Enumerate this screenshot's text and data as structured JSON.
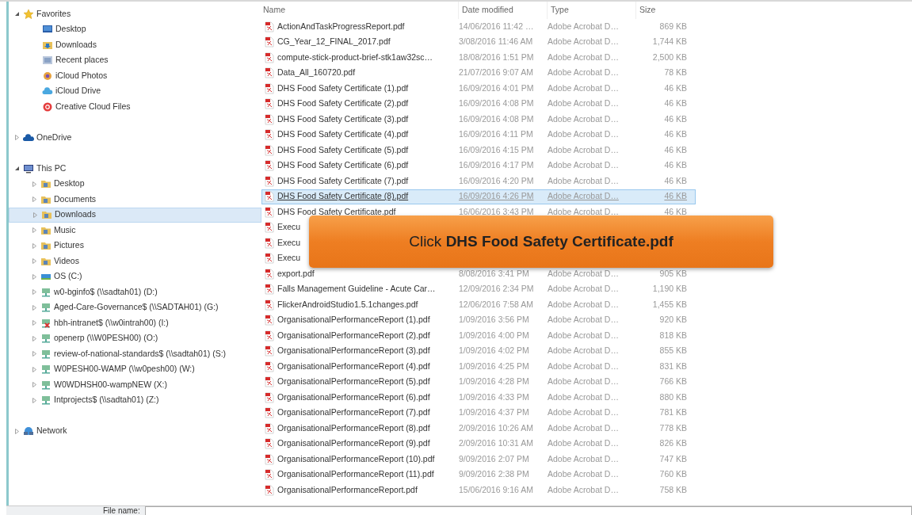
{
  "navigation": [
    {
      "label": "Favorites",
      "kind": "favorites",
      "expanded": true,
      "selected": false,
      "children": [
        {
          "label": "Desktop",
          "kind": "desktop",
          "selected": false
        },
        {
          "label": "Downloads",
          "kind": "downloads",
          "selected": false
        },
        {
          "label": "Recent places",
          "kind": "recent",
          "selected": false
        },
        {
          "label": "iCloud Photos",
          "kind": "photos",
          "selected": false
        },
        {
          "label": "iCloud Drive",
          "kind": "cloud",
          "selected": false
        },
        {
          "label": "Creative Cloud Files",
          "kind": "creative",
          "selected": false
        }
      ]
    },
    {
      "label": "OneDrive",
      "kind": "onedrive",
      "expanded": false,
      "selected": false
    },
    {
      "label": "This PC",
      "kind": "computer",
      "expanded": true,
      "selected": false,
      "children": [
        {
          "label": "Desktop",
          "kind": "folder",
          "expanded": false,
          "selected": false
        },
        {
          "label": "Documents",
          "kind": "folder",
          "expanded": false,
          "selected": false
        },
        {
          "label": "Downloads",
          "kind": "folder",
          "expanded": false,
          "selected": true
        },
        {
          "label": "Music",
          "kind": "folder",
          "expanded": false,
          "selected": false
        },
        {
          "label": "Pictures",
          "kind": "folder",
          "expanded": false,
          "selected": false
        },
        {
          "label": "Videos",
          "kind": "folder",
          "expanded": false,
          "selected": false
        },
        {
          "label": "OS (C:)",
          "kind": "disk",
          "expanded": false,
          "selected": false
        },
        {
          "label": "w0-bginfo$ (\\\\sadtah01) (D:)",
          "kind": "network-drive",
          "expanded": false,
          "selected": false
        },
        {
          "label": "Aged-Care-Governance$ (\\\\SADTAH01) (G:)",
          "kind": "network-drive",
          "expanded": false,
          "selected": false
        },
        {
          "label": "hbh-intranet$ (\\\\w0intrah00) (I:)",
          "kind": "disconnected-drive",
          "expanded": false,
          "selected": false
        },
        {
          "label": "openerp (\\\\W0PESH00) (O:)",
          "kind": "network-drive",
          "expanded": false,
          "selected": false
        },
        {
          "label": "review-of-national-standards$ (\\\\sadtah01) (S:)",
          "kind": "network-drive",
          "expanded": false,
          "selected": false
        },
        {
          "label": "W0PESH00-WAMP (\\\\w0pesh00) (W:)",
          "kind": "network-drive",
          "expanded": false,
          "selected": false
        },
        {
          "label": "W0WDHSH00-wampNEW (X:)",
          "kind": "network-drive",
          "expanded": false,
          "selected": false
        },
        {
          "label": "Intprojects$ (\\\\sadtah01) (Z:)",
          "kind": "network-drive",
          "expanded": false,
          "selected": false
        }
      ]
    },
    {
      "label": "Network",
      "kind": "network",
      "expanded": false,
      "selected": false
    }
  ],
  "file_list": {
    "columns": [
      "Name",
      "Date modified",
      "Type",
      "Size"
    ],
    "rows": [
      {
        "name": "ActionAndTaskProgressReport.pdf",
        "date": "14/06/2016 11:42 …",
        "type": "Adobe Acrobat D…",
        "size": "869 KB",
        "selected": false
      },
      {
        "name": "CG_Year_12_FINAL_2017.pdf",
        "date": "3/08/2016 11:46 AM",
        "type": "Adobe Acrobat D…",
        "size": "1,744 KB",
        "selected": false
      },
      {
        "name": "compute-stick-product-brief-stk1aw32sc…",
        "date": "18/08/2016 1:51 PM",
        "type": "Adobe Acrobat D…",
        "size": "2,500 KB",
        "selected": false
      },
      {
        "name": "Data_All_160720.pdf",
        "date": "21/07/2016 9:07 AM",
        "type": "Adobe Acrobat D…",
        "size": "78 KB",
        "selected": false
      },
      {
        "name": "DHS Food Safety Certificate (1).pdf",
        "date": "16/09/2016 4:01 PM",
        "type": "Adobe Acrobat D…",
        "size": "46 KB",
        "selected": false
      },
      {
        "name": "DHS Food Safety Certificate (2).pdf",
        "date": "16/09/2016 4:08 PM",
        "type": "Adobe Acrobat D…",
        "size": "46 KB",
        "selected": false
      },
      {
        "name": "DHS Food Safety Certificate (3).pdf",
        "date": "16/09/2016 4:08 PM",
        "type": "Adobe Acrobat D…",
        "size": "46 KB",
        "selected": false
      },
      {
        "name": "DHS Food Safety Certificate (4).pdf",
        "date": "16/09/2016 4:11 PM",
        "type": "Adobe Acrobat D…",
        "size": "46 KB",
        "selected": false
      },
      {
        "name": "DHS Food Safety Certificate (5).pdf",
        "date": "16/09/2016 4:15 PM",
        "type": "Adobe Acrobat D…",
        "size": "46 KB",
        "selected": false
      },
      {
        "name": "DHS Food Safety Certificate (6).pdf",
        "date": "16/09/2016 4:17 PM",
        "type": "Adobe Acrobat D…",
        "size": "46 KB",
        "selected": false
      },
      {
        "name": "DHS Food Safety Certificate (7).pdf",
        "date": "16/09/2016 4:20 PM",
        "type": "Adobe Acrobat D…",
        "size": "46 KB",
        "selected": false
      },
      {
        "name": "DHS Food Safety Certificate (8).pdf",
        "date": "16/09/2016 4:26 PM",
        "type": "Adobe Acrobat D…",
        "size": "46 KB",
        "selected": true
      },
      {
        "name": "DHS Food Safety Certificate.pdf",
        "date": "16/06/2016 3:43 PM",
        "type": "Adobe Acrobat D…",
        "size": "46 KB",
        "selected": false
      },
      {
        "name": "Execu",
        "selected": false
      },
      {
        "name": "Execu",
        "selected": false
      },
      {
        "name": "Execu",
        "selected": false
      },
      {
        "name": "export.pdf",
        "date": "8/08/2016 3:41 PM",
        "type": "Adobe Acrobat D…",
        "size": "905 KB",
        "selected": false
      },
      {
        "name": "Falls Management Guideline - Acute Car…",
        "date": "12/09/2016 2:34 PM",
        "type": "Adobe Acrobat D…",
        "size": "1,190 KB",
        "selected": false
      },
      {
        "name": "FlickerAndroidStudio1.5.1changes.pdf",
        "date": "12/06/2016 7:58 AM",
        "type": "Adobe Acrobat D…",
        "size": "1,455 KB",
        "selected": false
      },
      {
        "name": "OrganisationalPerformanceReport (1).pdf",
        "date": "1/09/2016 3:56 PM",
        "type": "Adobe Acrobat D…",
        "size": "920 KB",
        "selected": false
      },
      {
        "name": "OrganisationalPerformanceReport (2).pdf",
        "date": "1/09/2016 4:00 PM",
        "type": "Adobe Acrobat D…",
        "size": "818 KB",
        "selected": false
      },
      {
        "name": "OrganisationalPerformanceReport (3).pdf",
        "date": "1/09/2016 4:02 PM",
        "type": "Adobe Acrobat D…",
        "size": "855 KB",
        "selected": false
      },
      {
        "name": "OrganisationalPerformanceReport (4).pdf",
        "date": "1/09/2016 4:25 PM",
        "type": "Adobe Acrobat D…",
        "size": "831 KB",
        "selected": false
      },
      {
        "name": "OrganisationalPerformanceReport (5).pdf",
        "date": "1/09/2016 4:28 PM",
        "type": "Adobe Acrobat D…",
        "size": "766 KB",
        "selected": false
      },
      {
        "name": "OrganisationalPerformanceReport (6).pdf",
        "date": "1/09/2016 4:33 PM",
        "type": "Adobe Acrobat D…",
        "size": "880 KB",
        "selected": false
      },
      {
        "name": "OrganisationalPerformanceReport (7).pdf",
        "date": "1/09/2016 4:37 PM",
        "type": "Adobe Acrobat D…",
        "size": "781 KB",
        "selected": false
      },
      {
        "name": "OrganisationalPerformanceReport (8).pdf",
        "date": "2/09/2016 10:26 AM",
        "type": "Adobe Acrobat D…",
        "size": "778 KB",
        "selected": false
      },
      {
        "name": "OrganisationalPerformanceReport (9).pdf",
        "date": "2/09/2016 10:31 AM",
        "type": "Adobe Acrobat D…",
        "size": "826 KB",
        "selected": false
      },
      {
        "name": "OrganisationalPerformanceReport (10).pdf",
        "date": "9/09/2016 2:07 PM",
        "type": "Adobe Acrobat D…",
        "size": "747 KB",
        "selected": false
      },
      {
        "name": "OrganisationalPerformanceReport (11).pdf",
        "date": "9/09/2016 2:38 PM",
        "type": "Adobe Acrobat D…",
        "size": "760 KB",
        "selected": false
      },
      {
        "name": "OrganisationalPerformanceReport.pdf",
        "date": "15/06/2016 9:16 AM",
        "type": "Adobe Acrobat D…",
        "size": "758 KB",
        "selected": false
      }
    ]
  },
  "callout": {
    "text": "Click **DHS Food Safety Certificate.pdf**"
  },
  "file_name": {
    "label": "File name:"
  }
}
